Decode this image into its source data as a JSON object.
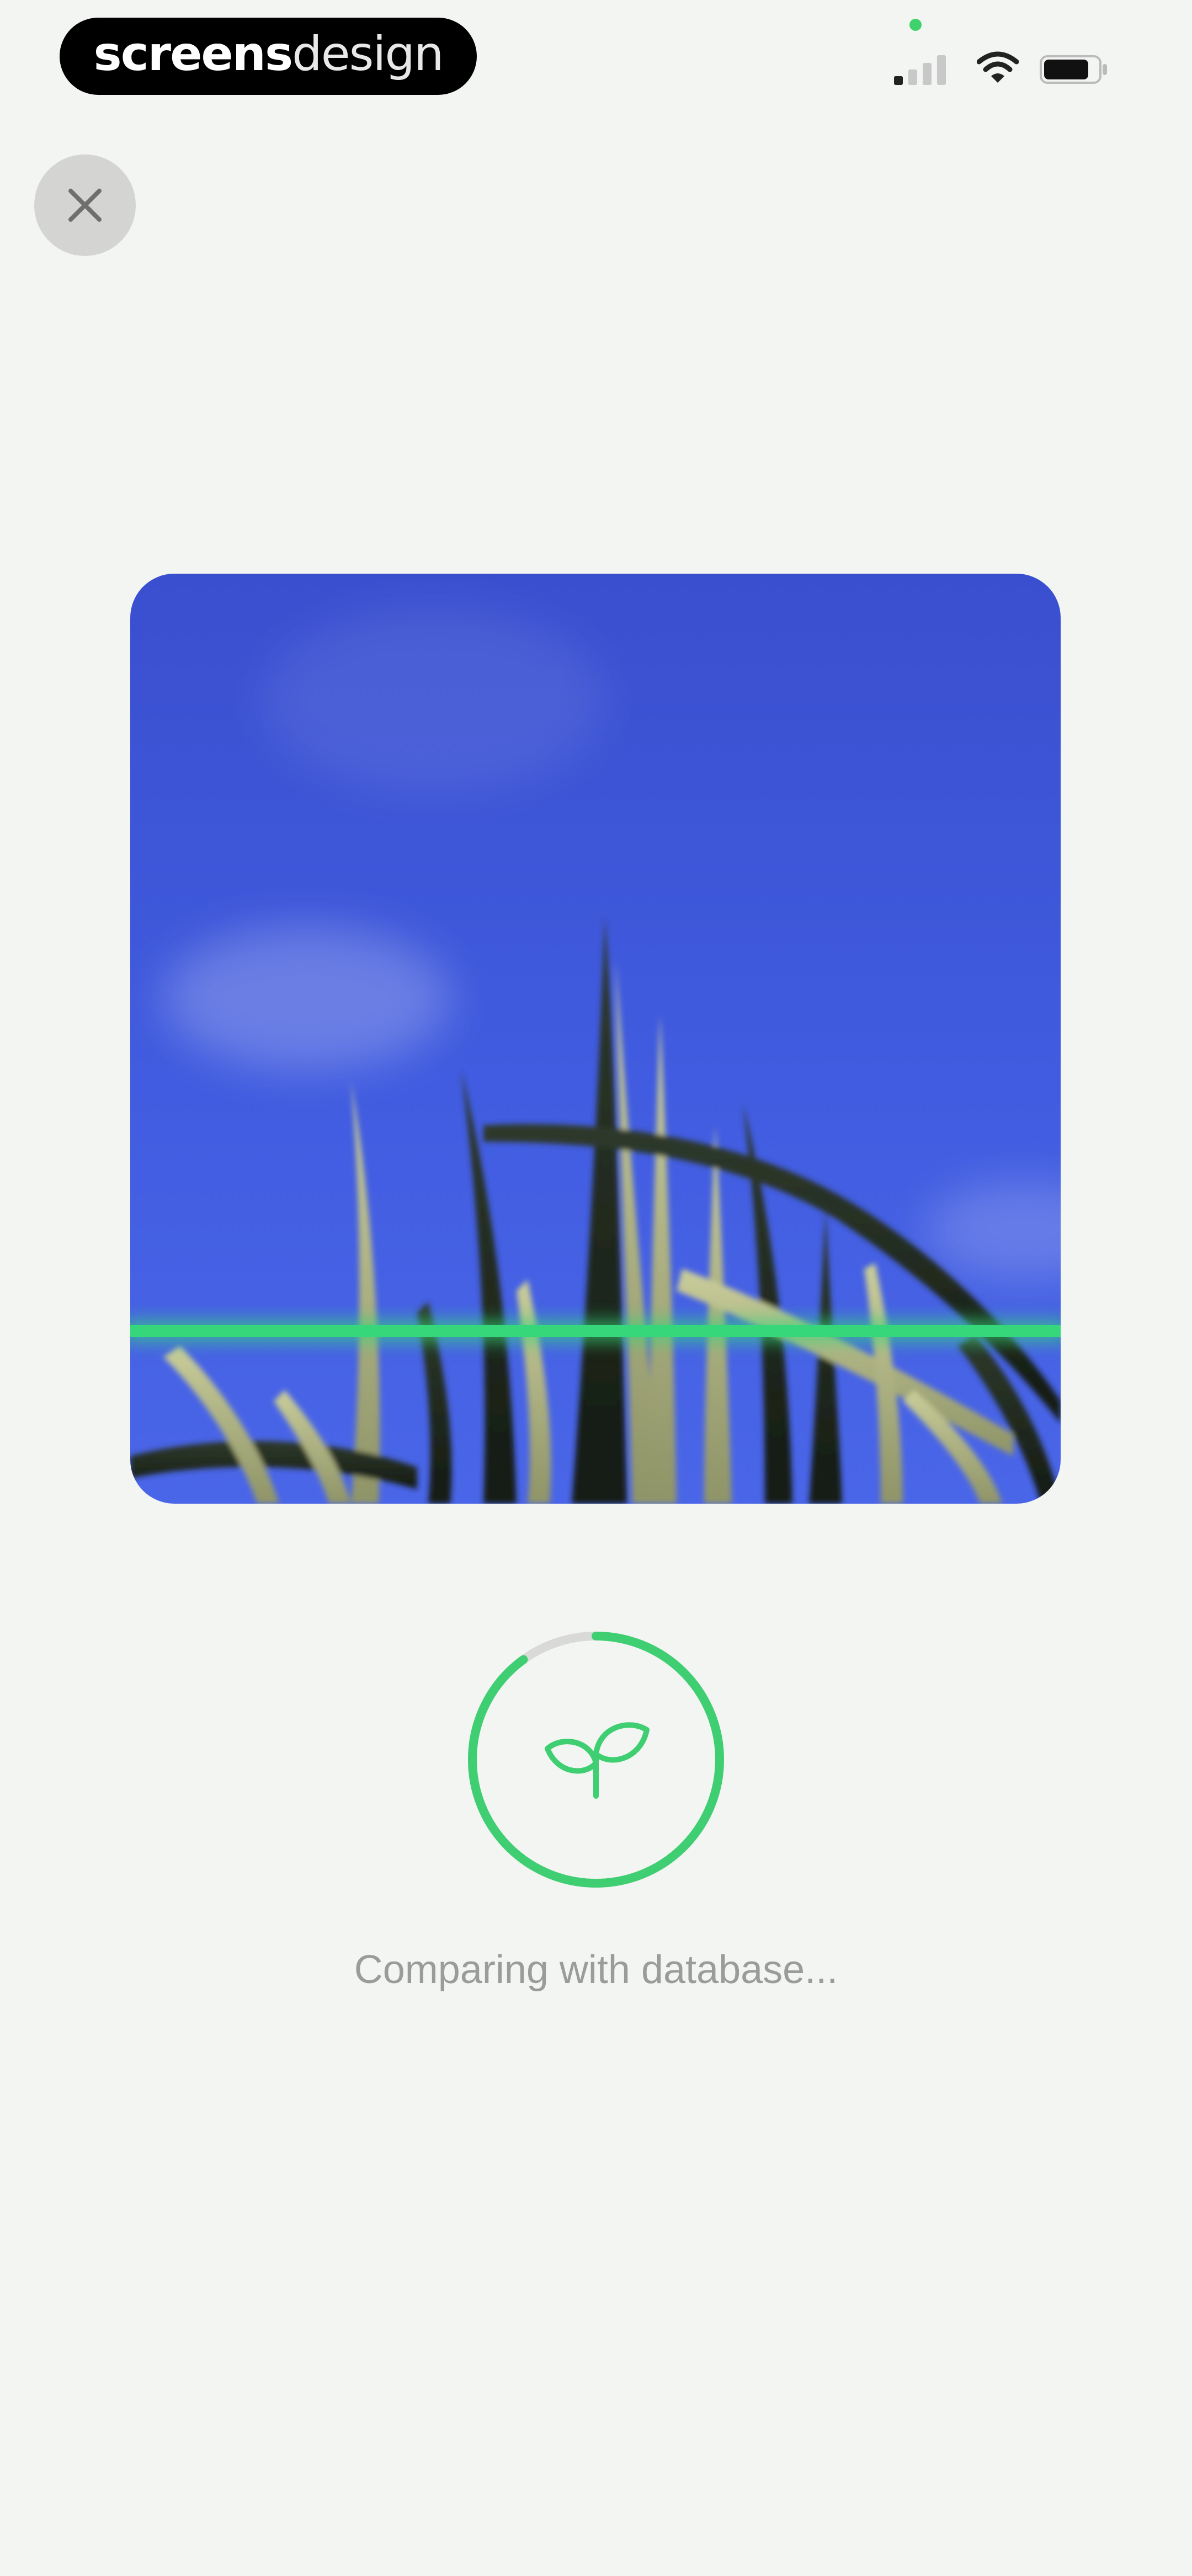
{
  "status_bar": {
    "brand_bold": "screens",
    "brand_regular": "design",
    "icons": [
      "signal-icon",
      "wifi-icon",
      "battery-icon"
    ]
  },
  "close_button": {
    "icon": "close-icon"
  },
  "scan": {
    "image": "grass-against-blue-sky",
    "scan_line_color": "#35d77a"
  },
  "progress": {
    "value": 0.9,
    "icon": "sprout-icon",
    "color": "#3fcf72",
    "track_color": "#d9dad8"
  },
  "status_text": "Comparing with database..."
}
